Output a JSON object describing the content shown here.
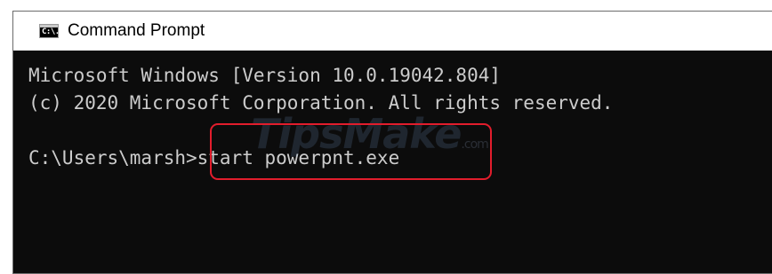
{
  "window": {
    "title": "Command Prompt",
    "icon": "cmd-icon",
    "icon_glyph": "C:\\."
  },
  "console": {
    "lines": [
      "Microsoft Windows [Version 10.0.19042.804]",
      "(c) 2020 Microsoft Corporation. All rights reserved.",
      "",
      "C:\\Users\\marsh>start powerpnt.exe"
    ]
  },
  "watermark": {
    "text": "TipsMake",
    "suffix": ".com"
  },
  "colors": {
    "console_bg": "#0c0c0c",
    "console_text": "#cccccc",
    "highlight": "#e21d2c",
    "titlebar_bg": "#ffffff"
  }
}
